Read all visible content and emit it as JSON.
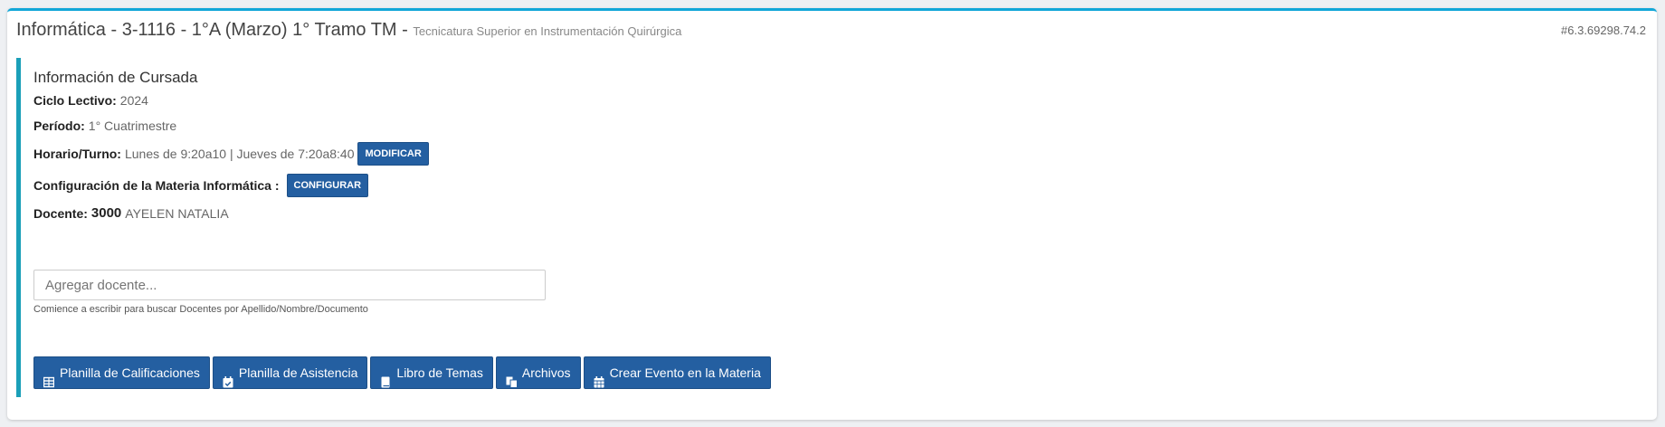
{
  "header": {
    "title": "Informática - 3-1116 - 1°A (Marzo) 1° Tramo TM -",
    "subtitle": "Tecnicatura Superior en Instrumentación Quirúrgica",
    "version": "#6.3.69298.74.2"
  },
  "info": {
    "title": "Información de Cursada",
    "ciclo_label": "Ciclo Lectivo:",
    "ciclo_value": "2024",
    "periodo_label": "Período:",
    "periodo_value": "1° Cuatrimestre",
    "horario_label": "Horario/Turno:",
    "horario_value": "Lunes de 9:20a10 | Jueves de 7:20a8:40",
    "modificar_label": "MODIFICAR",
    "config_label": "Configuración de la Materia Informática :",
    "configurar_label": "CONFIGURAR",
    "docente_label": "Docente:",
    "docente_num": "3000",
    "docente_name": "AYELEN NATALIA"
  },
  "search": {
    "placeholder": "Agregar docente...",
    "help": "Comience a escribir para buscar Docentes por Apellido/Nombre/Documento"
  },
  "actions": [
    {
      "label": "Planilla de Calificaciones",
      "icon": "table-icon"
    },
    {
      "label": "Planilla de Asistencia",
      "icon": "calendar-check-icon"
    },
    {
      "label": "Libro de Temas",
      "icon": "book-icon"
    },
    {
      "label": "Archivos",
      "icon": "files-icon"
    },
    {
      "label": "Crear Evento en la Materia",
      "icon": "calendar-icon"
    }
  ],
  "colors": {
    "accent_top": "#12a7d8",
    "accent_left": "#1b9fb8",
    "button": "#245fa1"
  }
}
